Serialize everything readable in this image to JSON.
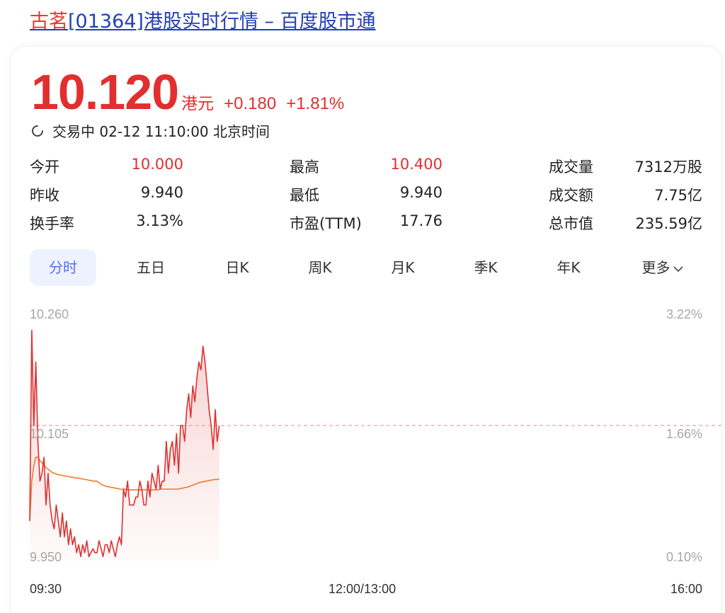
{
  "header": {
    "title_highlight": "古茗",
    "title_rest": "[01364]港股实时行情 – 百度股市通"
  },
  "quote": {
    "price": "10.120",
    "unit": "港元",
    "change": "+0.180",
    "change_pct": "+1.81%",
    "status": "交易中 02-12 11:10:00 北京时间"
  },
  "stats": {
    "open_label": "今开",
    "open_value": "10.000",
    "prev_close_label": "昨收",
    "prev_close_value": "9.940",
    "turnover_rate_label": "换手率",
    "turnover_rate_value": "3.13%",
    "high_label": "最高",
    "high_value": "10.400",
    "low_label": "最低",
    "low_value": "9.940",
    "pe_label": "市盈(TTM)",
    "pe_value": "17.76",
    "volume_label": "成交量",
    "volume_value": "7312万股",
    "amount_label": "成交额",
    "amount_value": "7.75亿",
    "market_cap_label": "总市值",
    "market_cap_value": "235.59亿"
  },
  "tabs": [
    "分时",
    "五日",
    "日K",
    "周K",
    "月K",
    "季K",
    "年K",
    "更多"
  ],
  "colors": {
    "up": "#e12f2f",
    "avg_line": "#ed7b2b",
    "accent": "#4e6ef2"
  },
  "chart_data": {
    "type": "line",
    "y_left_ticks": [
      "10.260",
      "10.105",
      "9.950"
    ],
    "y_right_ticks": [
      "3.22%",
      "1.66%",
      "0.10%"
    ],
    "x_ticks": [
      "09:30",
      "12:00/13:00",
      "16:00"
    ],
    "ylim": [
      9.95,
      10.26
    ],
    "ref_price": 10.12,
    "session_minutes": 330,
    "series": [
      {
        "key": "price",
        "values": [
          10.0,
          10.24,
          10.12,
          10.2,
          10.1,
          10.05,
          10.06,
          10.08,
          10.02,
          10.06,
          10.02,
          10.0,
          9.99,
          10.02,
          10.0,
          9.98,
          10.01,
          9.98,
          10.0,
          9.97,
          9.99,
          9.97,
          9.98,
          9.96,
          9.97,
          9.955,
          9.97,
          9.96,
          9.975,
          9.955,
          9.96,
          9.965,
          9.96,
          9.96,
          9.975,
          9.965,
          9.955,
          9.97,
          9.97,
          9.96,
          9.975,
          9.965,
          9.955,
          9.97,
          9.98,
          9.97,
          10.04,
          10.03,
          10.05,
          10.02,
          10.02,
          10.02,
          10.03,
          10.03,
          10.05,
          10.04,
          10.02,
          10.02,
          10.05,
          10.03,
          10.06,
          10.05,
          10.04,
          10.07,
          10.04,
          10.05,
          10.05,
          10.1,
          10.06,
          10.09,
          10.1,
          10.07,
          10.11,
          10.06,
          10.12,
          10.12,
          10.1,
          10.14,
          10.16,
          10.13,
          10.17,
          10.15,
          10.18,
          10.2,
          10.19,
          10.22,
          10.2,
          10.17,
          10.14,
          10.12,
          10.09,
          10.14,
          10.1,
          10.12
        ]
      },
      {
        "key": "average",
        "values": [
          10.0,
          10.05,
          10.07,
          10.08,
          10.08,
          10.076,
          10.073,
          10.07,
          10.067,
          10.065,
          10.063,
          10.061,
          10.06,
          10.059,
          10.058,
          10.058,
          10.057,
          10.057,
          10.056,
          10.056,
          10.055,
          10.055,
          10.054,
          10.054,
          10.054,
          10.053,
          10.053,
          10.052,
          10.052,
          10.051,
          10.051,
          10.05,
          10.05,
          10.05,
          10.048,
          10.046,
          10.045,
          10.044,
          10.043,
          10.043,
          10.042,
          10.042,
          10.041,
          10.041,
          10.04,
          10.04,
          10.04,
          10.04,
          10.039,
          10.039,
          10.039,
          10.039,
          10.039,
          10.039,
          10.039,
          10.039,
          10.039,
          10.039,
          10.039,
          10.039,
          10.039,
          10.039,
          10.039,
          10.039,
          10.04,
          10.04,
          10.04,
          10.04,
          10.04,
          10.04,
          10.04,
          10.04,
          10.04,
          10.04,
          10.041,
          10.041,
          10.042,
          10.042,
          10.043,
          10.044,
          10.045,
          10.046,
          10.047,
          10.048,
          10.049,
          10.049,
          10.05,
          10.05,
          10.051,
          10.051,
          10.052,
          10.052,
          10.052,
          10.053
        ]
      }
    ]
  }
}
